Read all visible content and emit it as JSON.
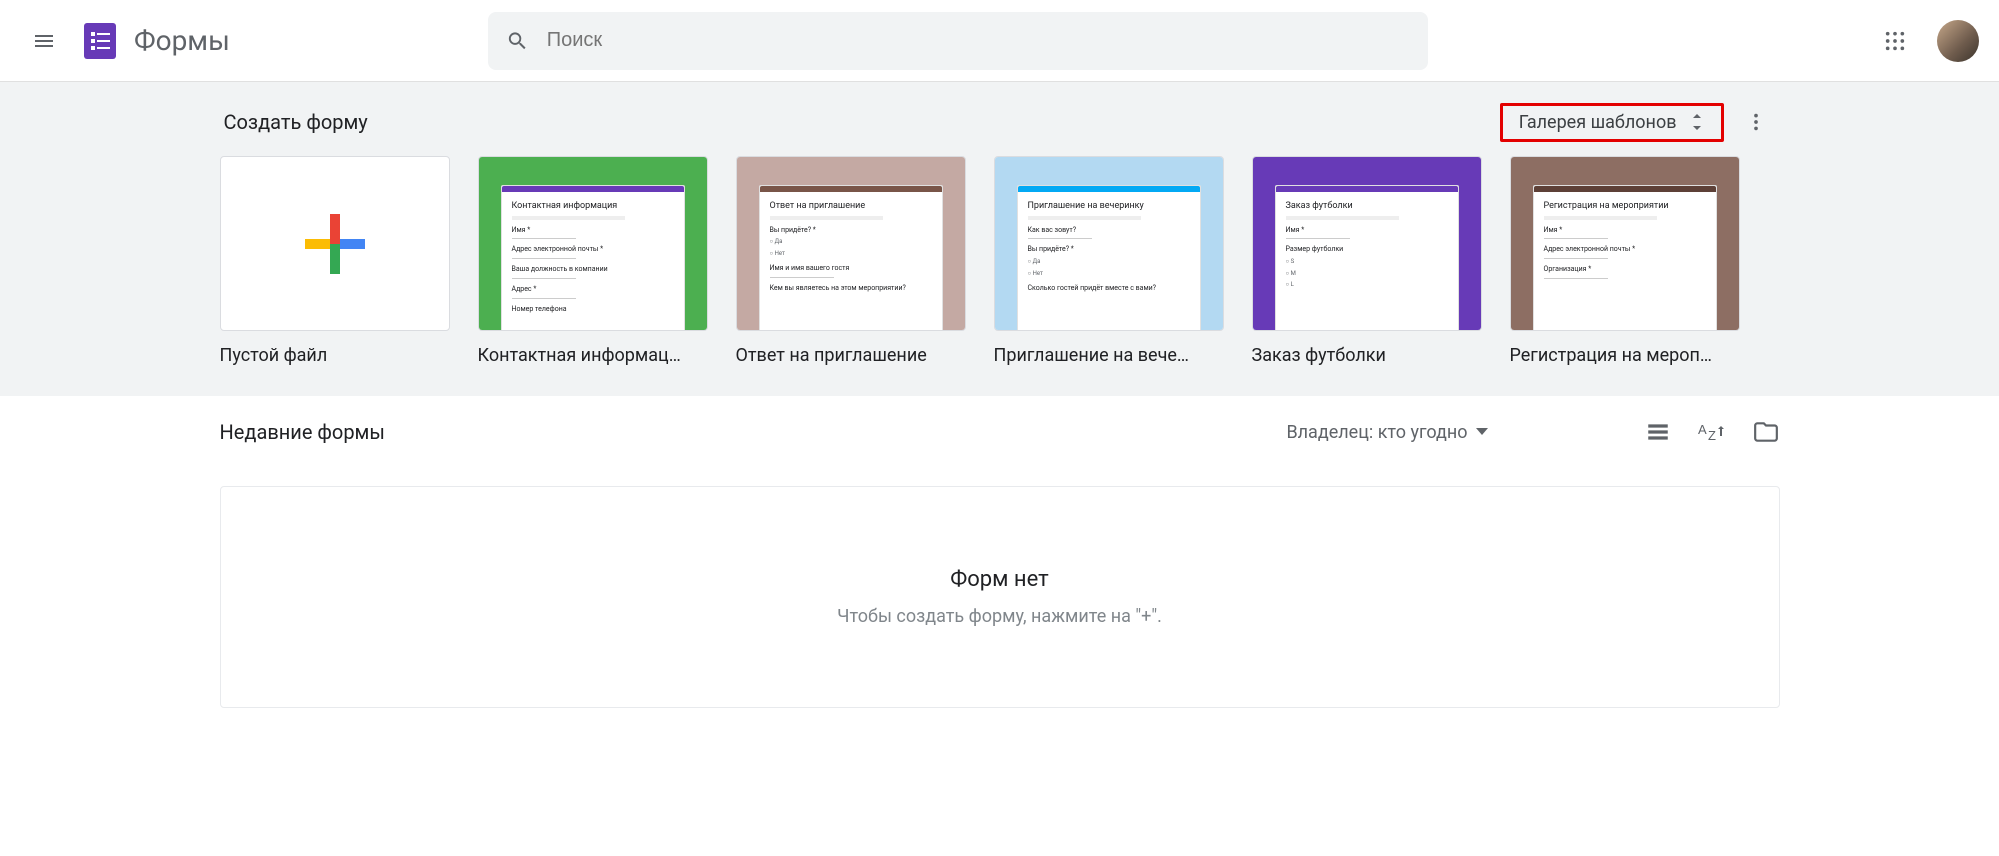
{
  "header": {
    "app_title": "Формы",
    "search_placeholder": "Поиск"
  },
  "templates": {
    "title": "Создать форму",
    "gallery_label": "Галерея шаблонов",
    "items": [
      {
        "label": "Пустой файл"
      },
      {
        "label": "Контактная информац…",
        "form_title": "Контактная информация",
        "bg": "#4caf50",
        "fields": [
          "Имя *",
          "Адрес электронной почты *",
          "Ваша должность в компании",
          "Адрес *",
          "Номер телефона"
        ]
      },
      {
        "label": "Ответ на приглашение",
        "form_title": "Ответ на приглашение",
        "bg": "#c4a9a3",
        "fields": [
          "Вы придёте? *",
          "Да",
          "Нет",
          "Имя и имя вашего гостя",
          "Кем вы являетесь на этом мероприятии?"
        ]
      },
      {
        "label": "Приглашение на вече…",
        "form_title": "Приглашение на вечеринку",
        "bg": "#b3d9f2",
        "fields": [
          "Как вас зовут?",
          "Вы придёте? *",
          "Да",
          "Нет",
          "Сколько гостей придёт вместе с вами?"
        ]
      },
      {
        "label": "Заказ футболки",
        "form_title": "Заказ футболки",
        "bg": "#673ab7",
        "fields": [
          "Имя *",
          "Размер футболки",
          "S",
          "M",
          "L"
        ]
      },
      {
        "label": "Регистрация на мероп…",
        "form_title": "Регистрация на мероприятии",
        "bg": "#8d6e63",
        "fields": [
          "Имя *",
          "Адрес электронной почты *",
          "Организация *"
        ]
      }
    ]
  },
  "recent": {
    "title": "Недавние формы",
    "owner_filter": "Владелец: кто угодно",
    "empty_title": "Форм нет",
    "empty_sub": "Чтобы создать форму, нажмите на \"+\"."
  }
}
